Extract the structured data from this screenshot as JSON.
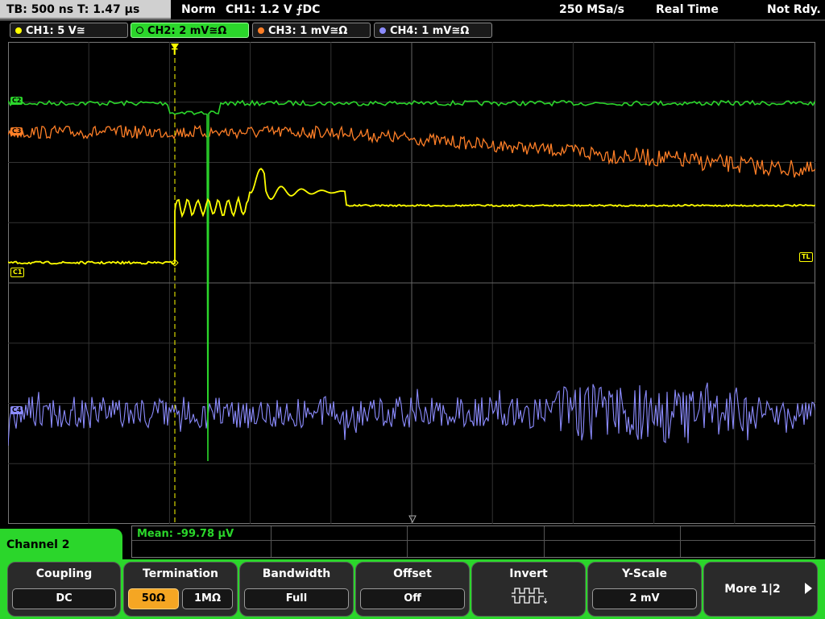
{
  "status": {
    "timebase": "TB: 500 ns   T: 1.47 µs",
    "trigger_mode": "Norm",
    "trigger_info": "CH1: 1.2 V ⨍DC",
    "sample_rate": "250 MSa/s",
    "acq_mode": "Real Time",
    "state": "Not Rdy."
  },
  "channels": [
    {
      "label": "CH1: 5 V≅",
      "color": "#ffff00"
    },
    {
      "label": "CH2: 2 mV≅Ω",
      "color": "#2bd62b"
    },
    {
      "label": "CH3: 1 mV≅Ω",
      "color": "#ff7f27"
    },
    {
      "label": "CH4: 1 mV≅Ω",
      "color": "#8c8cff"
    }
  ],
  "markers": {
    "trigger_t": "T",
    "ch2": "C2",
    "ch3": "C3",
    "ch1": "C1",
    "ch4": "C4",
    "trigger_level": "TL"
  },
  "measurement": {
    "mean": "Mean: -99.78 µV"
  },
  "menu": {
    "title": "Channel 2",
    "coupling": {
      "title": "Coupling",
      "value": "DC"
    },
    "termination": {
      "title": "Termination",
      "option1": "50Ω",
      "option2": "1MΩ",
      "selected": "50Ω"
    },
    "bandwidth": {
      "title": "Bandwidth",
      "value": "Full"
    },
    "offset": {
      "title": "Offset",
      "value": "Off"
    },
    "invert": {
      "title": "Invert"
    },
    "yscale": {
      "title": "Y-Scale",
      "value": "2 mV"
    },
    "more": {
      "label": "More 1|2"
    }
  }
}
